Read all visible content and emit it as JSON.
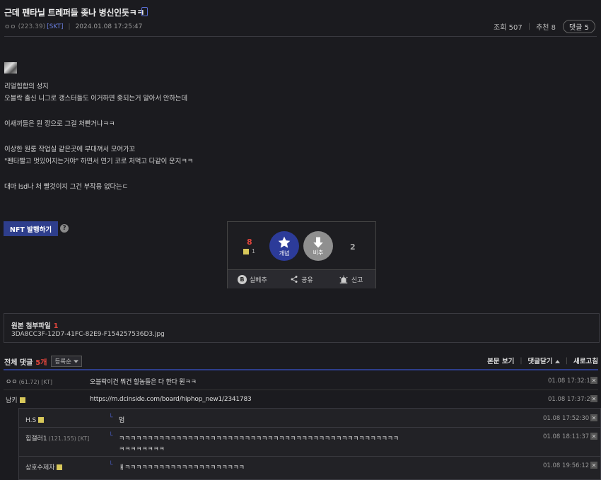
{
  "post": {
    "title": "근데 펜타닐 트레퍼들 좆나 병신인듯ㅋㅋ",
    "author": "ㅇㅇ",
    "author_ip": "(223.39)",
    "carrier": "[SKT]",
    "datetime": "2024.01.08 17:25:47",
    "views_label": "조회 507",
    "recommend_label": "추천 8",
    "comments_label": "댓글 5",
    "body_lines": [
      "리얼힙합의 성지",
      "오블락 출신 니그로 갱스터들도 이거하면 좆되는거 알아서 안하는데",
      "이새끼들은 뭔 깡으로 그걸 처빤거냐ㅋㅋ",
      "이상한 원룸 작업실 같은곳에 부대껴서 모여가꼬",
      "\"펜타빨고 멋있어지는거야\" 하면서 연기 코로 처먹고 다같이 운지ㅋㅋ",
      "대마 lsd나 처 빨것이지 그건 부작용 없다는ㄷ"
    ]
  },
  "nft": {
    "button_label": "NFT 발행하기",
    "help_icon": "question-icon"
  },
  "vote": {
    "up_count": "8",
    "fixed_count": "1",
    "up_label": "개념",
    "down_label": "비추",
    "down_count": "2",
    "actions": [
      {
        "icon": "b-badge-icon",
        "label": "실베추"
      },
      {
        "icon": "share-icon",
        "label": "공유"
      },
      {
        "icon": "siren-icon",
        "label": "신고"
      }
    ]
  },
  "attachments": {
    "title": "원본 첨부파일",
    "count": "1",
    "files": [
      "3DA8CC3F-12D7-41FC-82E9-F154257536D3.jpg"
    ]
  },
  "comments_header": {
    "label": "전체 댓글",
    "count": "5개",
    "sort": "등록순",
    "view_post": "본문 보기",
    "close_comments": "댓글닫기",
    "refresh": "새로고침"
  },
  "comments": [
    {
      "nick": "ㅇㅇ",
      "ip": "(61.72) [KT]",
      "text": "오블락이건 뭐건 할놈들은 다 한다 뭔ㅋㅋ",
      "date": "01.08 17:32:18"
    },
    {
      "nick": "남키",
      "ip": "",
      "text": "https://m.dcinside.com/board/hiphop_new1/2341783",
      "date": "01.08 17:37:20"
    }
  ],
  "replies": [
    {
      "nick": "H.S",
      "ip": "",
      "text": "멈",
      "text2": "",
      "date": "01.08 17:52:30"
    },
    {
      "nick": "힙갤러1",
      "ip": "(121.155) [KT]",
      "text": "ㅋㅋㅋㅋㅋㅋㅋㅋㅋㅋㅋㅋㅋㅋㅋㅋㅋㅋㅋㅋㅋㅋㅋㅋㅋㅋㅋㅋㅋㅋㅋㅋㅋㅋㅋㅋㅋㅋㅋㅋㅋㅋㅋㅋㅋㅋㅋㅋㅋ",
      "text2": "ㅋㅋㅋㅋㅋㅋㅋㅋ",
      "date": "01.08 18:11:37"
    },
    {
      "nick": "상호수제자",
      "ip": "",
      "text": "ㅒㅋㅋㅋㅋㅋㅋㅋㅋㅋㅋㅋㅋㅋㅋㅋㅋㅋㅋㅋㅋㅋ",
      "text2": "",
      "date": "01.08 19:56:12"
    }
  ],
  "colors": {
    "background": "#1b1b1f",
    "accent": "#2e3e8c",
    "highlight": "#e0453d"
  }
}
